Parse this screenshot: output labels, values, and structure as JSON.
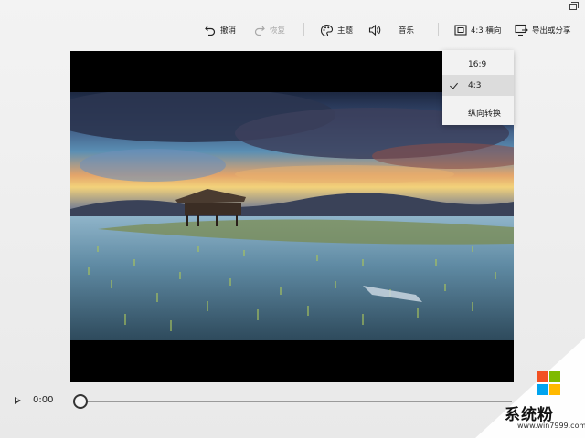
{
  "toolbar": {
    "undo_label": "撤消",
    "redo_label": "恢复",
    "theme_label": "主题",
    "music_label": "音乐",
    "aspect_label": "4:3 横向",
    "export_label": "导出或分享",
    "icons": {
      "undo": "undo-icon",
      "redo": "redo-icon",
      "theme": "palette-icon",
      "music": "speaker-icon",
      "aspect": "aspect-ratio-icon",
      "export": "export-share-icon"
    }
  },
  "aspect_menu": {
    "items": [
      {
        "label": "16:9",
        "selected": false
      },
      {
        "label": "4:3",
        "selected": true
      },
      {
        "label": "纵向转换",
        "selected": false
      }
    ]
  },
  "playback": {
    "time": "0:00",
    "progress": 0
  },
  "watermark": {
    "text": "系统粉",
    "url": "www.win7999.com",
    "colors": [
      "#f25022",
      "#7fba00",
      "#00a4ef",
      "#ffb900"
    ]
  },
  "colors": {
    "background": "#efefef",
    "stage": "#000000",
    "menu_bg": "#f2f2f2",
    "menu_selected": "#dcdcdc"
  }
}
